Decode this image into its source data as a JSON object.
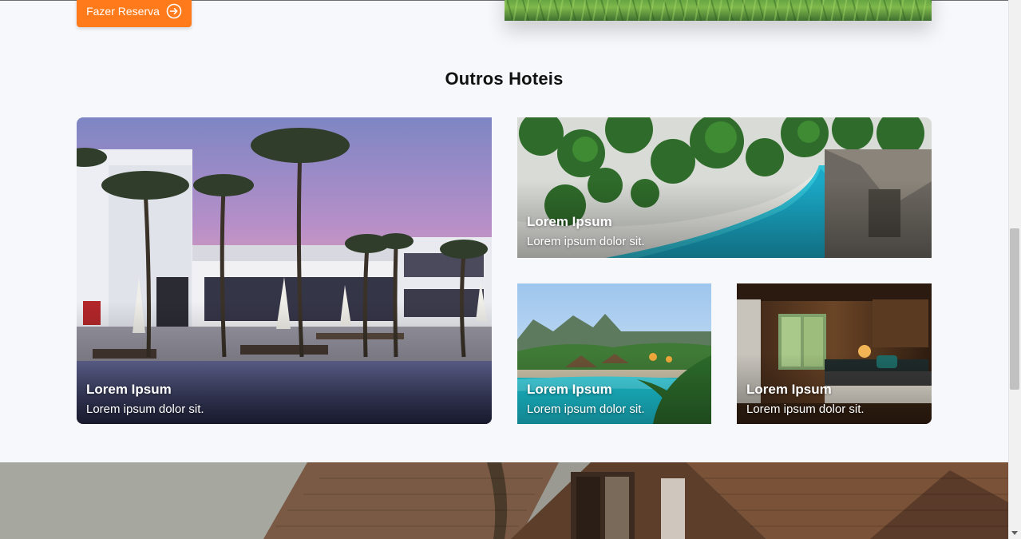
{
  "hero": {
    "reserve_label": "Fazer Reserva",
    "reserve_icon": "arrow-right-circle-icon"
  },
  "others": {
    "title": "Outros Hoteis",
    "cards": [
      {
        "title": "Lorem Ipsum",
        "text": "Lorem ipsum dolor sit."
      },
      {
        "title": "Lorem Ipsum",
        "text": "Lorem ipsum dolor sit."
      },
      {
        "title": "Lorem Ipsum",
        "text": "Lorem ipsum dolor sit."
      },
      {
        "title": "Lorem Ipsum",
        "text": "Lorem ipsum dolor sit."
      }
    ]
  },
  "colors": {
    "accent": "#ff7a1a",
    "background": "#f7f8fb",
    "title": "#111111"
  }
}
